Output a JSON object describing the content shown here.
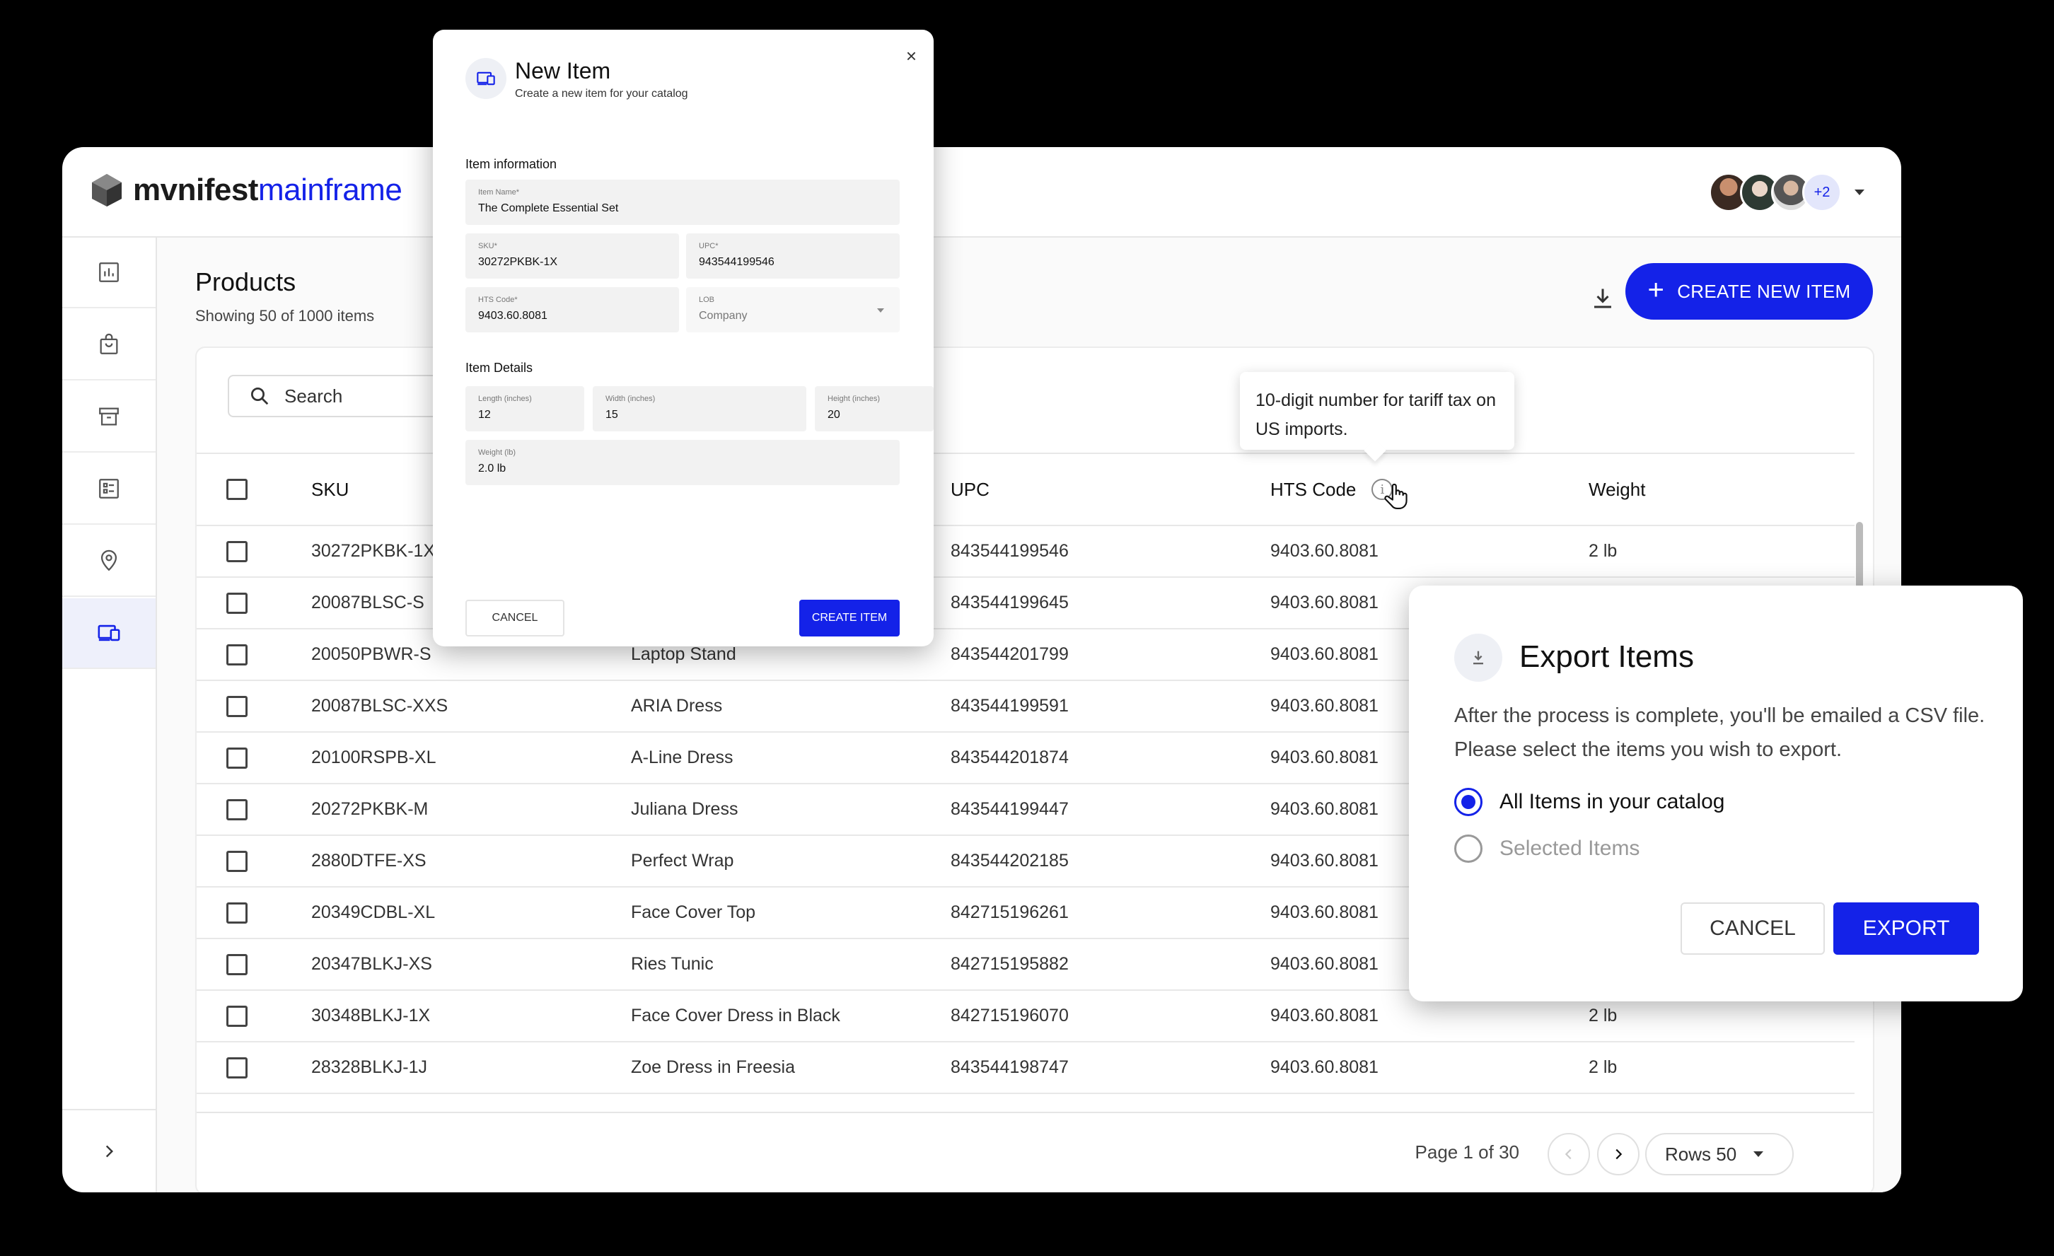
{
  "app": {
    "logo_primary": "mvnifest",
    "logo_secondary": "mainframe",
    "avatars_more": "+2"
  },
  "sidebar": {
    "items": [
      {
        "icon": "chart-icon"
      },
      {
        "icon": "shopping-bag-icon"
      },
      {
        "icon": "archive-icon"
      },
      {
        "icon": "list-icon"
      },
      {
        "icon": "location-pin-icon"
      },
      {
        "icon": "devices-icon",
        "active": true
      }
    ]
  },
  "page": {
    "title": "Products",
    "subtitle": "Showing 50 of 1000 items",
    "create_label": "CREATE NEW ITEM"
  },
  "search": {
    "placeholder": "Search"
  },
  "table": {
    "headers": {
      "sku": "SKU",
      "upc": "UPC",
      "hts": "HTS Code",
      "weight": "Weight"
    },
    "rows": [
      {
        "sku": "30272PKBK-1X",
        "name": "",
        "upc": "843544199546",
        "hts": "9403.60.8081",
        "weight": "2 lb"
      },
      {
        "sku": "20087BLSC-S",
        "name": "",
        "upc": "843544199645",
        "hts": "9403.60.8081",
        "weight": ""
      },
      {
        "sku": "20050PBWR-S",
        "name": "Laptop Stand",
        "upc": "843544201799",
        "hts": "9403.60.8081",
        "weight": ""
      },
      {
        "sku": "20087BLSC-XXS",
        "name": "ARIA Dress",
        "upc": "843544199591",
        "hts": "9403.60.8081",
        "weight": ""
      },
      {
        "sku": "20100RSPB-XL",
        "name": "A-Line Dress",
        "upc": "843544201874",
        "hts": "9403.60.8081",
        "weight": ""
      },
      {
        "sku": "20272PKBK-M",
        "name": "Juliana Dress",
        "upc": "843544199447",
        "hts": "9403.60.8081",
        "weight": ""
      },
      {
        "sku": "2880DTFE-XS",
        "name": "Perfect Wrap",
        "upc": "843544202185",
        "hts": "9403.60.8081",
        "weight": ""
      },
      {
        "sku": "20349CDBL-XL",
        "name": "Face Cover Top",
        "upc": "842715196261",
        "hts": "9403.60.8081",
        "weight": ""
      },
      {
        "sku": "20347BLKJ-XS",
        "name": "Ries Tunic",
        "upc": "842715195882",
        "hts": "9403.60.8081",
        "weight": ""
      },
      {
        "sku": "30348BLKJ-1X",
        "name": "Face Cover Dress in Black",
        "upc": "842715196070",
        "hts": "9403.60.8081",
        "weight": "2 lb"
      },
      {
        "sku": "28328BLKJ-1J",
        "name": "Zoe Dress in Freesia",
        "upc": "843544198747",
        "hts": "9403.60.8081",
        "weight": "2 lb"
      }
    ]
  },
  "pagination": {
    "page_text": "Page 1 of 30",
    "rows_label": "Rows 50"
  },
  "tooltip": {
    "text": "10-digit number for tariff tax on US imports."
  },
  "new_item": {
    "title": "New Item",
    "subtitle": "Create a new item for your catalog",
    "section_info": "Item information",
    "section_details": "Item Details",
    "fields": {
      "name": {
        "label": "Item Name*",
        "value": "The Complete Essential Set"
      },
      "sku": {
        "label": "SKU*",
        "value": "30272PKBK-1X"
      },
      "upc": {
        "label": "UPC*",
        "value": "943544199546"
      },
      "hts": {
        "label": "HTS Code*",
        "value": "9403.60.8081"
      },
      "lob": {
        "label": "LOB",
        "value": "Company"
      },
      "length": {
        "label": "Length (inches)",
        "value": "12"
      },
      "width": {
        "label": "Width (inches)",
        "value": "15"
      },
      "height": {
        "label": "Height (inches)",
        "value": "20"
      },
      "weight": {
        "label": "Weight (lb)",
        "value": "2.0 lb"
      }
    },
    "cancel_label": "CANCEL",
    "create_label": "CREATE ITEM"
  },
  "export": {
    "title": "Export Items",
    "description": "After the process is complete, you'll be emailed a CSV file. Please select the items you wish to export.",
    "option_all": "All Items in your catalog",
    "option_selected": "Selected Items",
    "selected_option": "all",
    "cancel_label": "CANCEL",
    "export_label": "EXPORT"
  },
  "colors": {
    "accent": "#1422e8",
    "background": "#000000"
  }
}
